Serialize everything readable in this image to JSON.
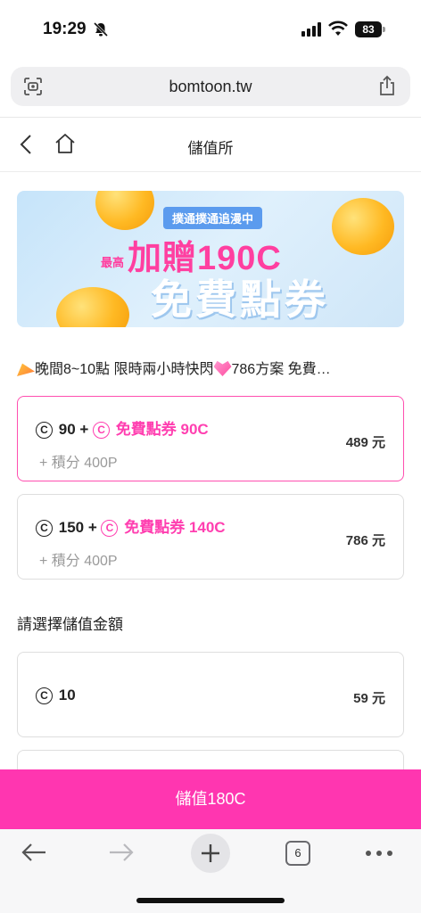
{
  "status_bar": {
    "time": "19:29",
    "battery": "83"
  },
  "address_bar": {
    "url": "bomtoon.tw"
  },
  "header": {
    "title": "儲值所"
  },
  "banner": {
    "tag": "撲通撲通追漫中",
    "prefix": "最高",
    "headline": "加贈190C",
    "subheadline": "免費點券"
  },
  "promo": {
    "text_before": "晚間8~10點 限時兩小時快閃",
    "text_after": "786方案 免費…"
  },
  "packages": [
    {
      "coins": "90 +",
      "bonus": "免費點券 90C",
      "points": "+ 積分 400P",
      "price": "489 元"
    },
    {
      "coins": "150 +",
      "bonus": "免費點券 140C",
      "points": "+ 積分 400P",
      "price": "786 元"
    }
  ],
  "coin_symbol": "C",
  "section": {
    "title": "請選擇儲值金額"
  },
  "amounts": [
    {
      "coins": "10",
      "price": "59 元"
    }
  ],
  "charge_button": {
    "label": "儲值180C"
  },
  "toolbar": {
    "tab_count": "6"
  },
  "colors": {
    "accent_pink": "#ff36b0",
    "selected_border": "#ff4fb0"
  }
}
